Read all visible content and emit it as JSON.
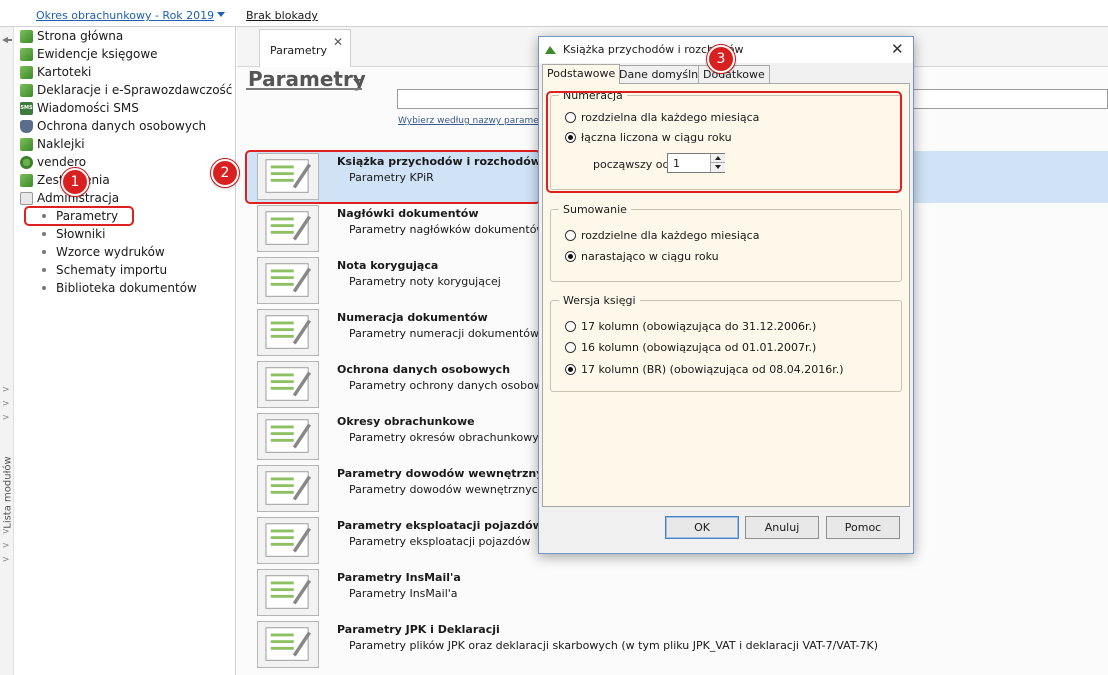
{
  "topbar": {
    "period_link": "Okres obrachunkowy - Rok 2019",
    "lock_link": "Brak blokady"
  },
  "module_list_label": "Lista modułów",
  "sidebar": {
    "items": [
      {
        "label": "Strona główna",
        "icon": "home-icon"
      },
      {
        "label": "Ewidencje księgowe",
        "icon": "ledger-icon"
      },
      {
        "label": "Kartoteki",
        "icon": "cards-icon"
      },
      {
        "label": "Deklaracje i e-Sprawozdawczość",
        "icon": "declaration-icon"
      },
      {
        "label": "Wiadomości SMS",
        "icon": "sms-icon"
      },
      {
        "label": "Ochrona danych osobowych",
        "icon": "shield-icon"
      },
      {
        "label": "Naklejki",
        "icon": "sticker-icon"
      },
      {
        "label": "vendero",
        "icon": "vendero-icon"
      },
      {
        "label": "Zestawienia",
        "icon": "report-icon"
      },
      {
        "label": "Administracja",
        "icon": "admin-icon"
      }
    ],
    "sub_items": [
      {
        "label": "Parametry"
      },
      {
        "label": "Słowniki"
      },
      {
        "label": "Wzorce wydruków"
      },
      {
        "label": "Schematy importu"
      },
      {
        "label": "Biblioteka dokumentów"
      }
    ]
  },
  "annotations": {
    "one": "1",
    "two": "2",
    "three": "3",
    "color": "#d92020"
  },
  "main": {
    "tab_label": "Parametry",
    "tab_close": "✕",
    "page_title": "Parametry",
    "search_hint": "Wybierz według nazwy parametrów",
    "rows": [
      {
        "title": "Książka przychodów i rozchodów",
        "subtitle": "Parametry KPiR",
        "selected": true
      },
      {
        "title": "Nagłówki dokumentów",
        "subtitle": "Parametry nagłówków dokumentów"
      },
      {
        "title": "Nota korygująca",
        "subtitle": "Parametry noty korygującej"
      },
      {
        "title": "Numeracja dokumentów",
        "subtitle": "Parametry numeracji dokumentów"
      },
      {
        "title": "Ochrona danych osobowych",
        "subtitle": "Parametry ochrony danych osobowych"
      },
      {
        "title": "Okresy obrachunkowe",
        "subtitle": "Parametry okresów obrachunkowych"
      },
      {
        "title": "Parametry dowodów wewnętrznych",
        "subtitle": "Parametry dowodów wewnętrznych"
      },
      {
        "title": "Parametry eksploatacji pojazdów",
        "subtitle": "Parametry eksploatacji pojazdów"
      },
      {
        "title": "Parametry InsMail'a",
        "subtitle": "Parametry InsMail'a"
      },
      {
        "title": "Parametry JPK i Deklaracji",
        "subtitle": "Parametry plików JPK oraz deklaracji skarbowych (w tym pliku JPK_VAT i deklaracji VAT-7/VAT-7K)"
      }
    ]
  },
  "dialog": {
    "title": "Książka przychodów i rozchodów",
    "close": "✕",
    "tabs": [
      "Podstawowe",
      "Dane domyślne",
      "Dodatkowe"
    ],
    "numeracja": {
      "legend": "Numeracja",
      "options": [
        "rozdzielna dla każdego miesiąca",
        "łączna liczona w ciągu roku"
      ],
      "selected_index": 1,
      "since_label": "począwszy od:",
      "since_value": "1"
    },
    "sumowanie": {
      "legend": "Sumowanie",
      "options": [
        "rozdzielne dla każdego miesiąca",
        "narastająco w ciągu roku"
      ],
      "selected_index": 1
    },
    "wersja": {
      "legend": "Wersja księgi",
      "options": [
        "17 kolumn (obowiązująca do 31.12.2006r.)",
        "16 kolumn (obowiązująca od 01.01.2007r.)",
        "17 kolumn (BR) (obowiązująca od 08.04.2016r.)"
      ],
      "selected_index": 2
    },
    "buttons": {
      "ok": "OK",
      "cancel": "Anuluj",
      "help": "Pomoc"
    }
  },
  "colors": {
    "selected_row": "#cfe2f6",
    "dialog_body": "#fdf8e9",
    "link": "#1f5fb5"
  }
}
